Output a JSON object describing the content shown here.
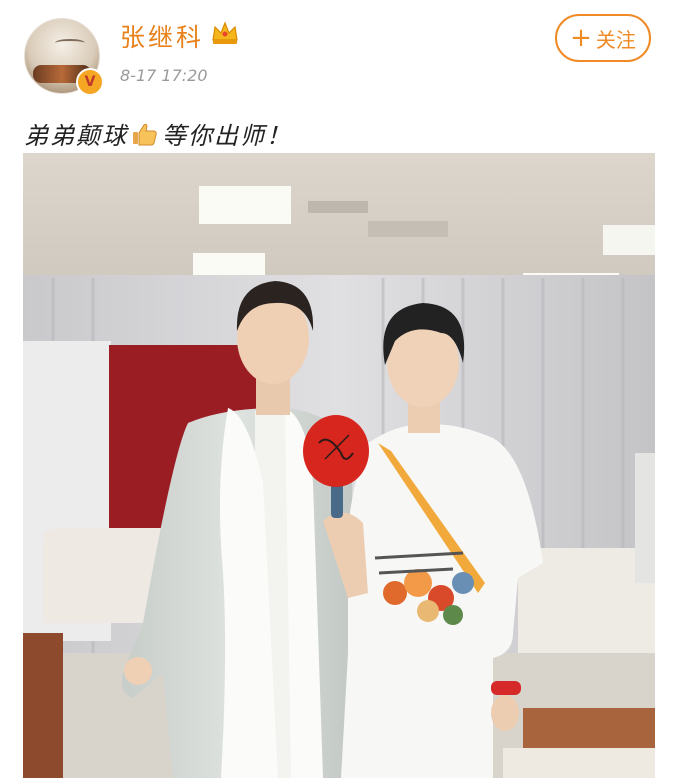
{
  "post": {
    "author": {
      "name": "张继科",
      "badge_icon": "crown-icon",
      "verified_icon": "verified-v-icon",
      "verified_mark": "V"
    },
    "timestamp": "8-17 17:20",
    "follow_button": {
      "plus": "+",
      "label": "关注"
    },
    "text_before_emoji": "弟弟颠球",
    "emoji": "thumbs-up-icon",
    "text_after_emoji": "等你出师！",
    "colors": {
      "username": "#e8811a",
      "follow": "#f08a24",
      "timestamp": "#9a9a9a"
    }
  }
}
